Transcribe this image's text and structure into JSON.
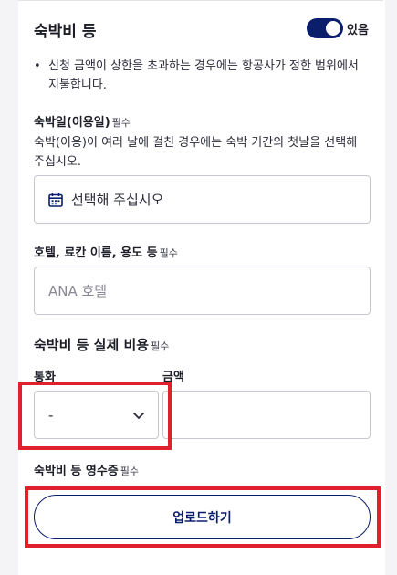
{
  "section": {
    "title": "숙박비 등",
    "toggle_label": "있음",
    "toggle_on": true
  },
  "note": {
    "bullet": "•",
    "text": "신청 금액이 상한을 초과하는 경우에는 항공사가 정한 범위에서 지불합니다."
  },
  "stay_date": {
    "label": "숙박일(이용일)",
    "required": "필수",
    "help": "숙박(이용)이 여러 날에 걸친 경우에는 숙박 기간의 첫날을 선택해 주십시오.",
    "placeholder": "선택해 주십시오"
  },
  "hotel": {
    "label": "호텔, 료칸 이름, 용도 등",
    "required": "필수",
    "placeholder": "ANA 호텔"
  },
  "cost": {
    "title": "숙박비 등 실제 비용",
    "required": "필수",
    "currency_label": "통화",
    "currency_value": "-",
    "amount_label": "금액",
    "amount_value": ""
  },
  "receipt": {
    "label": "숙박비 등 영수증",
    "required": "필수",
    "upload_label": "업로드하기"
  },
  "colors": {
    "accent": "#0b1e6b",
    "highlight": "#e0202c"
  }
}
